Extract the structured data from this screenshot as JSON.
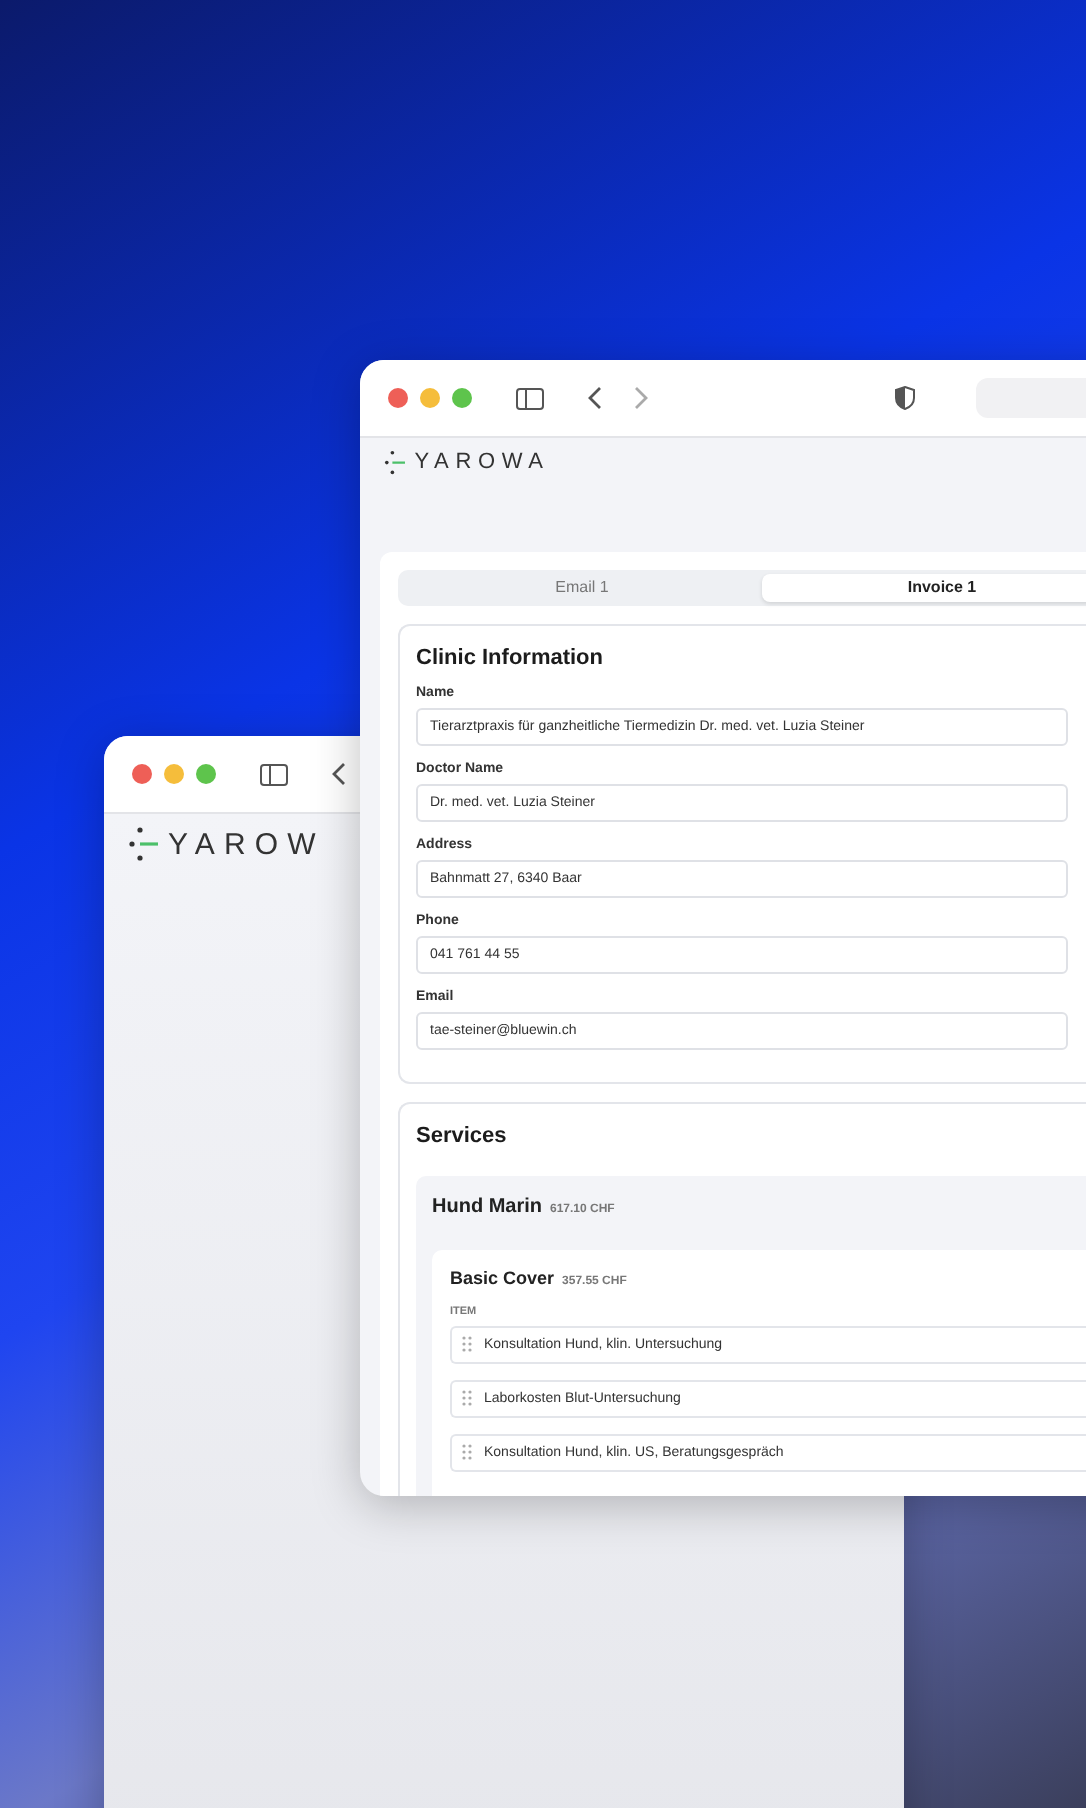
{
  "back_window": {
    "logo": "YAROW"
  },
  "front_window": {
    "logo": "YAROWA",
    "tabs": [
      {
        "label": "Email 1",
        "selected": false
      },
      {
        "label": "Invoice 1",
        "selected": true
      }
    ],
    "clinic": {
      "title": "Clinic Information",
      "fields": [
        {
          "label": "Name",
          "value": "Tierarztpraxis für ganzheitliche Tiermedizin Dr. med. vet. Luzia Steiner"
        },
        {
          "label": "Doctor Name",
          "value": "Dr. med. vet. Luzia Steiner"
        },
        {
          "label": "Address",
          "value": "Bahnmatt 27, 6340 Baar"
        },
        {
          "label": "Phone",
          "value": "041 761 44 55"
        },
        {
          "label": "Email",
          "value": "tae-steiner@bluewin.ch"
        }
      ]
    },
    "services": {
      "title": "Services",
      "patient": {
        "name": "Hund Marin",
        "total": "617.10 CHF",
        "cover": {
          "name": "Basic Cover",
          "total": "357.55 CHF",
          "column": "ITEM",
          "items": [
            "Konsultation Hund, klin. Untersuchung",
            "Laborkosten Blut-Untersuchung",
            "Konsultation Hund, klin. US, Beratungsgespräch"
          ]
        }
      }
    }
  }
}
